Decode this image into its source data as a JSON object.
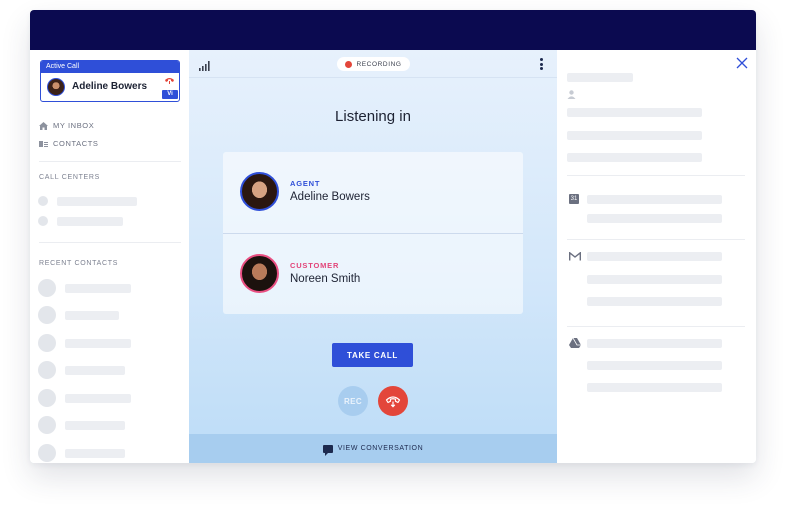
{
  "sidebar": {
    "active_call_label": "Active Call",
    "active_caller": "Adeline Bowers",
    "badge": "Vi",
    "nav": [
      {
        "label": "MY INBOX",
        "icon": "home-icon"
      },
      {
        "label": "CONTACTS",
        "icon": "contacts-icon"
      }
    ],
    "call_centers_title": "CALL CENTERS",
    "recent_contacts_title": "RECENT CONTACTS"
  },
  "call": {
    "recording_label": "RECORDING",
    "heading": "Listening in",
    "agent": {
      "role": "AGENT",
      "name": "Adeline Bowers"
    },
    "customer": {
      "role": "CUSTOMER",
      "name": "Noreen Smith"
    },
    "take_call_label": "TAKE CALL",
    "rec_label": "REC",
    "view_conversation_label": "VIEW CONVERSATION"
  },
  "right_panel": {
    "calendar_icon_text": "31"
  },
  "colors": {
    "brand_navy": "#0b0a50",
    "accent_blue": "#2f4fd8",
    "hangup_red": "#e3463a",
    "customer_pink": "#e24479"
  }
}
